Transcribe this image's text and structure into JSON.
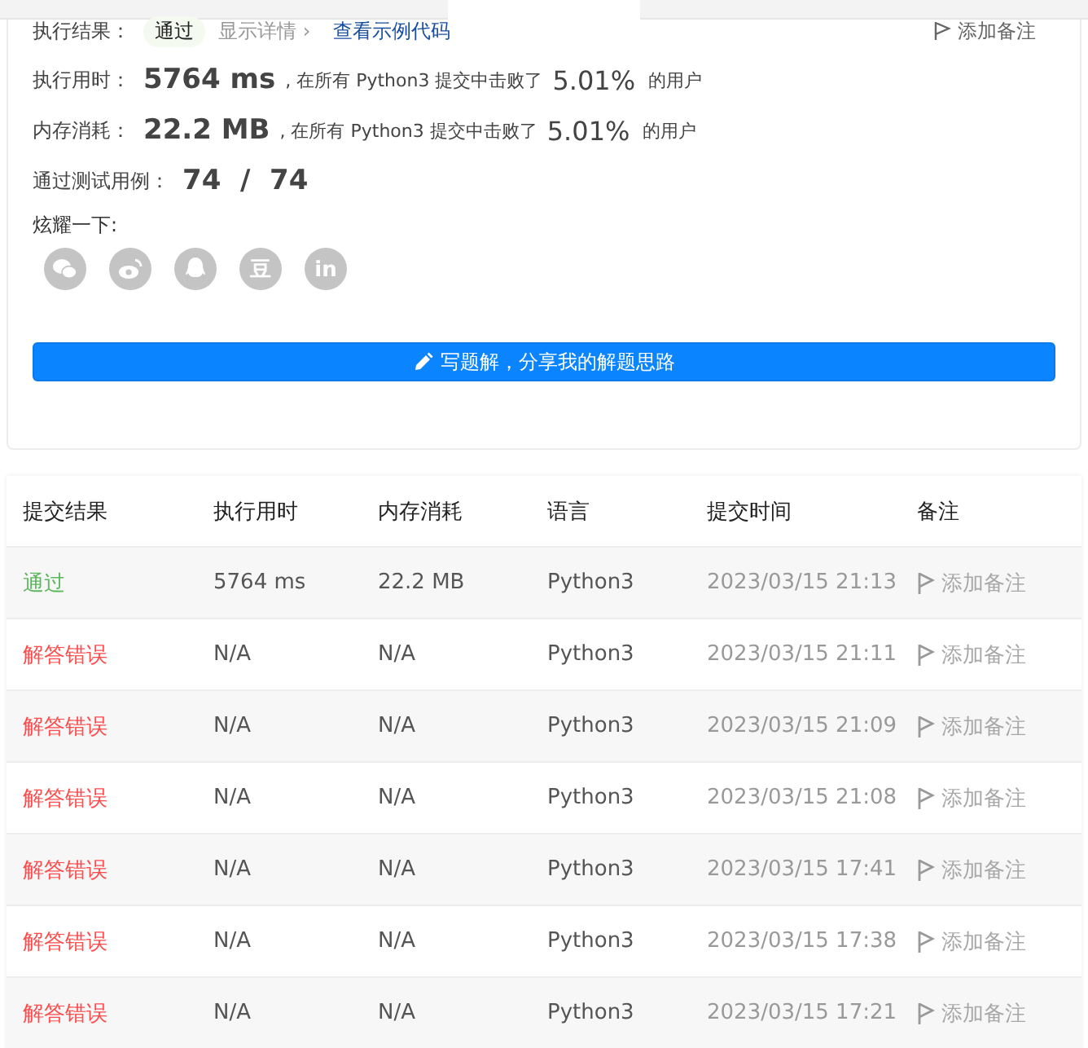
{
  "result": {
    "label": "执行结果：",
    "status": "通过",
    "details_link": "显示详情 ›",
    "sample_link": "查看示例代码",
    "add_note": "添加备注"
  },
  "stats": [
    {
      "label": "执行用时：",
      "value": "5764 ms",
      "middle": ", 在所有 Python3 提交中击败了",
      "percent": "5.01%",
      "suffix": "的用户"
    },
    {
      "label": "内存消耗：",
      "value": "22.2 MB",
      "middle": ", 在所有 Python3 提交中击败了",
      "percent": "5.01%",
      "suffix": "的用户"
    }
  ],
  "tests": {
    "label": "通过测试用例：",
    "value": "74  /  74"
  },
  "share": {
    "label": "炫耀一下:",
    "icons": [
      {
        "kind": "wechat"
      },
      {
        "kind": "weibo"
      },
      {
        "kind": "qq"
      },
      {
        "kind": "douban",
        "glyph": "豆"
      },
      {
        "kind": "linkedin",
        "glyph": "in"
      }
    ]
  },
  "write_button": "写题解，分享我的解题思路",
  "table": {
    "columns": [
      "提交结果",
      "执行用时",
      "内存消耗",
      "语言",
      "提交时间",
      "备注"
    ],
    "rows": [
      {
        "kind": "accepted",
        "result": "通过",
        "time": "5764 ms",
        "memory": "22.2 MB",
        "language": "Python3",
        "submitted": "2023/03/15 21:13",
        "note": "添加备注"
      },
      {
        "kind": "wrong",
        "result": "解答错误",
        "time": "N/A",
        "memory": "N/A",
        "language": "Python3",
        "submitted": "2023/03/15 21:11",
        "note": "添加备注"
      },
      {
        "kind": "wrong",
        "result": "解答错误",
        "time": "N/A",
        "memory": "N/A",
        "language": "Python3",
        "submitted": "2023/03/15 21:09",
        "note": "添加备注"
      },
      {
        "kind": "wrong",
        "result": "解答错误",
        "time": "N/A",
        "memory": "N/A",
        "language": "Python3",
        "submitted": "2023/03/15 21:08",
        "note": "添加备注"
      },
      {
        "kind": "wrong",
        "result": "解答错误",
        "time": "N/A",
        "memory": "N/A",
        "language": "Python3",
        "submitted": "2023/03/15 17:41",
        "note": "添加备注"
      },
      {
        "kind": "wrong",
        "result": "解答错误",
        "time": "N/A",
        "memory": "N/A",
        "language": "Python3",
        "submitted": "2023/03/15 17:38",
        "note": "添加备注"
      },
      {
        "kind": "wrong",
        "result": "解答错误",
        "time": "N/A",
        "memory": "N/A",
        "language": "Python3",
        "submitted": "2023/03/15 17:21",
        "note": "添加备注"
      }
    ]
  }
}
